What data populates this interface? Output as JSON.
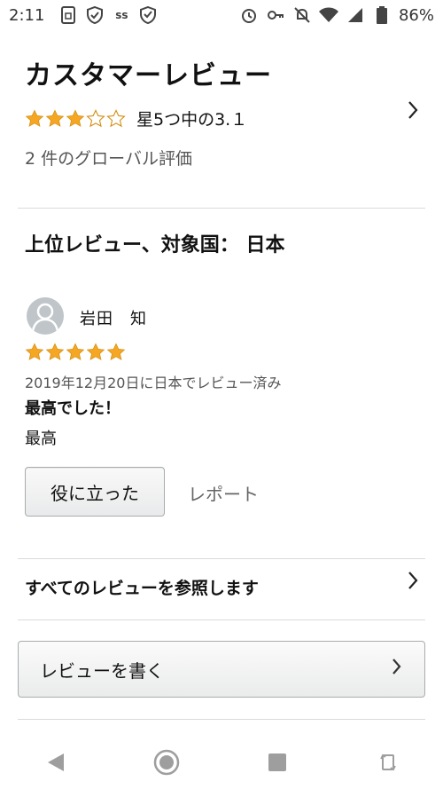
{
  "status_bar": {
    "time": "2:11",
    "battery": "86%",
    "icons": [
      "sim-icon",
      "shield-icon",
      "vpn-icon",
      "check-shield-icon",
      "alarm-icon",
      "key-icon",
      "mute-icon",
      "wifi-icon",
      "signal-icon",
      "battery-icon"
    ]
  },
  "reviews": {
    "title": "カスタマーレビュー",
    "rating_text": "星5つ中の3.１",
    "rating_value": 3.1,
    "global_count": "2 件のグローバル評価",
    "top_reviews_title": "上位レビュー、対象国： 日本",
    "items": [
      {
        "reviewer": "岩田　知",
        "stars": 5,
        "date": "2019年12月20日に日本でレビュー済み",
        "title": "最高でした！",
        "body": "最高",
        "helpful_label": "役に立った",
        "report_label": "レポート"
      }
    ],
    "see_all": "すべてのレビューを参照します",
    "write_review": "レビューを書く"
  },
  "colors": {
    "star": "#f5a623",
    "star_outline": "#e0a030",
    "text": "#111111",
    "muted": "#555555"
  }
}
